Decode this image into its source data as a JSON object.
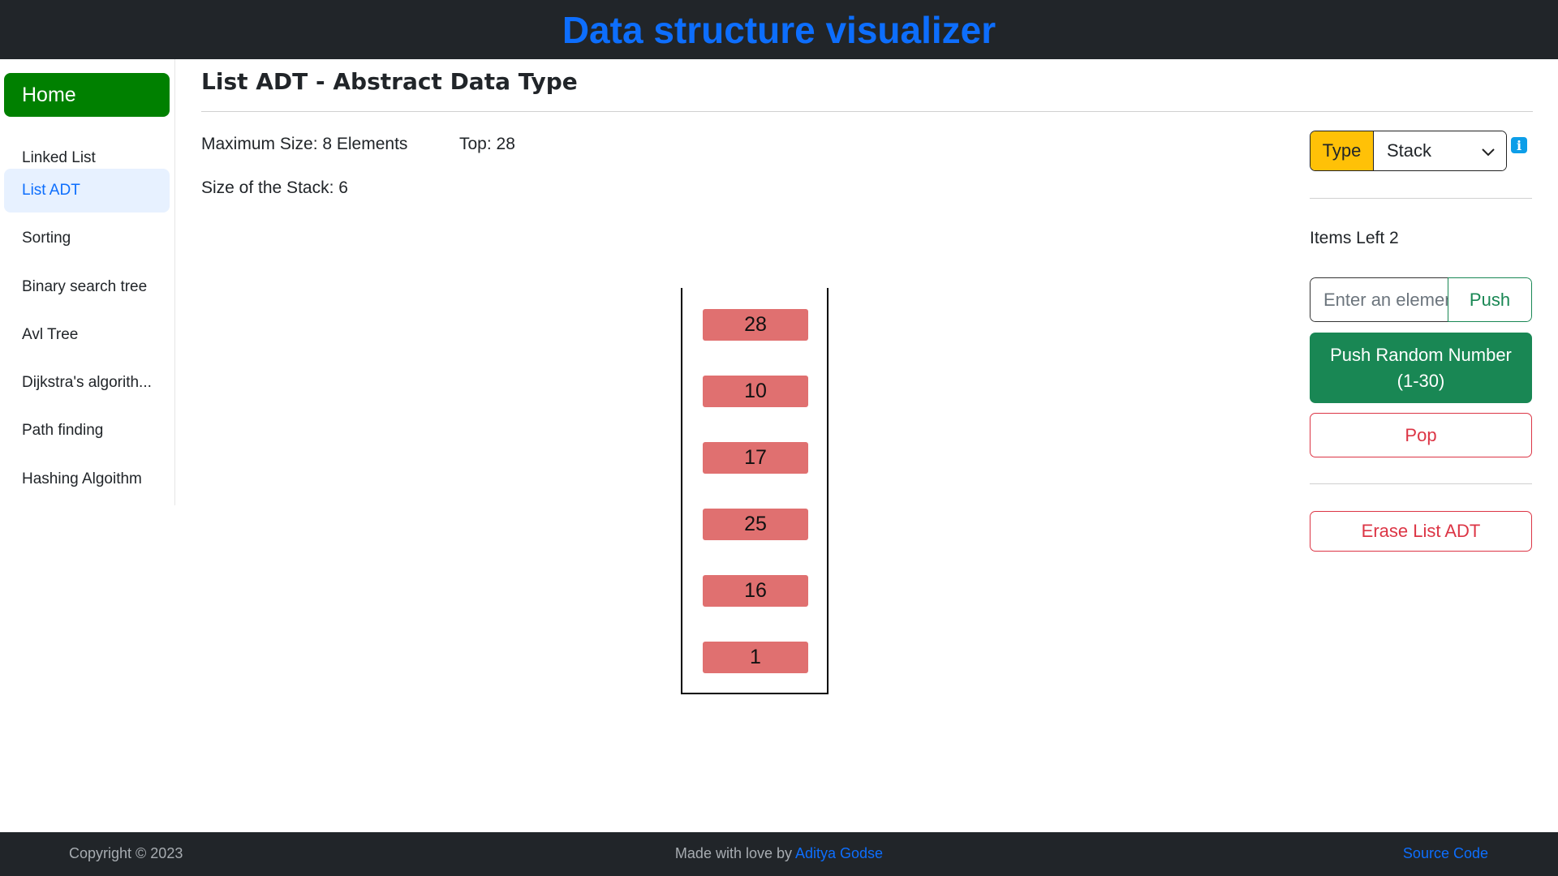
{
  "header": {
    "title": "Data structure visualizer"
  },
  "sidebar": {
    "home_label": "Home",
    "items": [
      {
        "label": "Linked List"
      },
      {
        "label": "List ADT"
      },
      {
        "label": "Sorting"
      },
      {
        "label": "Binary search tree"
      },
      {
        "label": "Avl Tree"
      },
      {
        "label": "Dijkstra's algorith..."
      },
      {
        "label": "Path finding"
      },
      {
        "label": "Hashing Algoithm"
      }
    ],
    "active_item": "List ADT"
  },
  "main": {
    "title": "List ADT - Abstract Data Type",
    "max_size": "Maximum Size: 8 Elements",
    "top": "Top: 28",
    "stack_size": "Size of the Stack: 6",
    "stack_items": [
      "28",
      "10",
      "17",
      "25",
      "16",
      "1"
    ]
  },
  "controls": {
    "type_label": "Type",
    "type_value": "Stack",
    "info_icon": "i",
    "items_left": "Items Left 2",
    "input_placeholder": "Enter an element",
    "push_label": "Push",
    "push_random_label": "Push Random Number (1-30)",
    "pop_label": "Pop",
    "erase_label": "Erase List ADT"
  },
  "footer": {
    "copyright": "Copyright © 2023",
    "made_with": "Made with love by ",
    "author": "Aditya Godse",
    "source_code": "Source Code"
  },
  "colors": {
    "header_bg": "#212529",
    "title_blue": "#0d6efd",
    "home_green": "#008000",
    "stack_item": "#e07070",
    "type_yellow": "#ffc107",
    "success_green": "#198754",
    "danger_red": "#dc3545"
  }
}
